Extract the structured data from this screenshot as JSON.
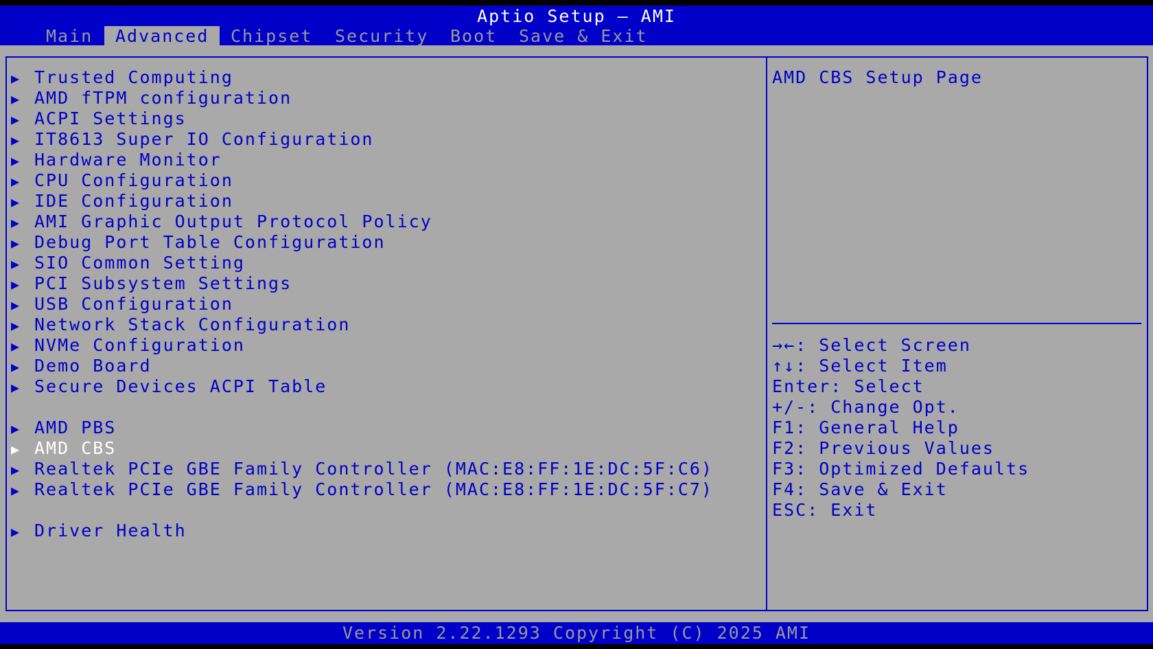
{
  "header": {
    "title": "Aptio Setup – AMI"
  },
  "tabs": [
    {
      "label": "Main",
      "active": false
    },
    {
      "label": "Advanced",
      "active": true
    },
    {
      "label": "Chipset",
      "active": false
    },
    {
      "label": "Security",
      "active": false
    },
    {
      "label": "Boot",
      "active": false
    },
    {
      "label": "Save & Exit",
      "active": false
    }
  ],
  "menu": {
    "items": [
      "Trusted Computing",
      "AMD fTPM configuration",
      "ACPI Settings",
      "IT8613 Super IO Configuration",
      "Hardware Monitor",
      "CPU Configuration",
      "IDE Configuration",
      "AMI Graphic Output Protocol Policy",
      "Debug Port Table Configuration",
      "SIO Common Setting",
      "PCI Subsystem Settings",
      "USB Configuration",
      "Network Stack Configuration",
      "NVMe Configuration",
      "Demo Board",
      "Secure Devices ACPI Table",
      "AMD PBS",
      "AMD CBS",
      "Realtek PCIe GBE Family Controller (MAC:E8:FF:1E:DC:5F:C6)",
      "Realtek PCIe GBE Family Controller (MAC:E8:FF:1E:DC:5F:C7)",
      "Driver Health"
    ],
    "selected": "AMD CBS",
    "arrow_glyph": "▶"
  },
  "help": {
    "description": "AMD CBS Setup Page",
    "keys": [
      "→←: Select Screen",
      "↑↓: Select Item",
      "Enter: Select",
      "+/-: Change Opt.",
      "F1: General Help",
      "F2: Previous Values",
      "F3: Optimized Defaults",
      "F4: Save & Exit",
      "ESC: Exit"
    ]
  },
  "footer": {
    "text": "Version 2.22.1293 Copyright (C) 2025 AMI"
  },
  "colors": {
    "blue": "#0000c8",
    "grey": "#a9a9a9",
    "white": "#ffffff",
    "dim": "#9a9a9a"
  }
}
